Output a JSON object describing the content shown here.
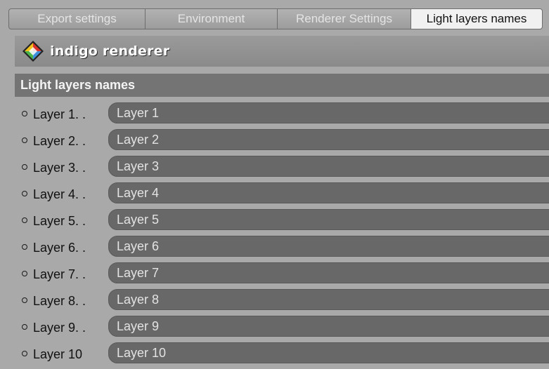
{
  "tabs": [
    {
      "label": "Export settings"
    },
    {
      "label": "Environment"
    },
    {
      "label": "Renderer Settings"
    },
    {
      "label": "Light layers names"
    }
  ],
  "header": {
    "brand": "indigo renderer",
    "logo_colors": [
      "#f2c21a",
      "#d8322a",
      "#3a8fd8",
      "#4ab34a"
    ]
  },
  "section": {
    "title": "Light layers names"
  },
  "layers": [
    {
      "label": "Layer 1. .",
      "value": "Layer 1"
    },
    {
      "label": "Layer 2. .",
      "value": "Layer 2"
    },
    {
      "label": "Layer 3. .",
      "value": "Layer 3"
    },
    {
      "label": "Layer 4. .",
      "value": "Layer 4"
    },
    {
      "label": "Layer 5. .",
      "value": "Layer 5"
    },
    {
      "label": "Layer 6. .",
      "value": "Layer 6"
    },
    {
      "label": "Layer 7. .",
      "value": "Layer 7"
    },
    {
      "label": "Layer 8. .",
      "value": "Layer 8"
    },
    {
      "label": "Layer 9. .",
      "value": "Layer 9"
    },
    {
      "label": "Layer 10",
      "value": "Layer 10"
    }
  ]
}
